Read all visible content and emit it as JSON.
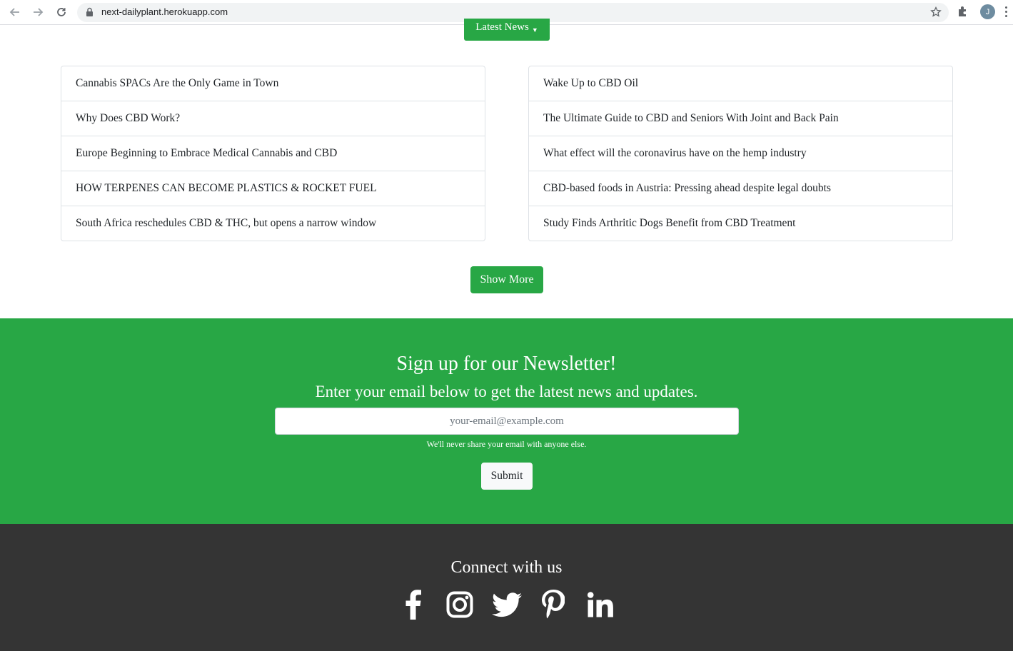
{
  "browser": {
    "url": "next-dailyplant.herokuapp.com",
    "profile_initial": "J"
  },
  "page": {
    "dropdown_label": "Latest News",
    "left_articles": [
      "Cannabis SPACs Are the Only Game in Town",
      "Why Does CBD Work?",
      "Europe Beginning to Embrace Medical Cannabis and CBD",
      "HOW TERPENES CAN BECOME PLASTICS & ROCKET FUEL",
      "South Africa reschedules CBD & THC, but opens a narrow window"
    ],
    "right_articles": [
      "Wake Up to CBD Oil",
      "The Ultimate Guide to CBD and Seniors With Joint and Back Pain",
      "What effect will the coronavirus have on the hemp industry",
      "CBD-based foods in Austria: Pressing ahead despite legal doubts",
      "Study Finds Arthritic Dogs Benefit from CBD Treatment"
    ],
    "show_more_label": "Show More"
  },
  "newsletter": {
    "title": "Sign up for our Newsletter!",
    "subtitle": "Enter your email below to get the latest news and updates.",
    "email_placeholder": "your-email@example.com",
    "email_value": "",
    "note": "We'll never share your email with anyone else.",
    "submit_label": "Submit"
  },
  "footer": {
    "connect_label": "Connect with us",
    "socials": [
      "facebook-icon",
      "instagram-icon",
      "twitter-icon",
      "pinterest-icon",
      "linkedin-icon"
    ]
  },
  "colors": {
    "brand_green": "#28a745",
    "footer_dark": "#343434"
  }
}
